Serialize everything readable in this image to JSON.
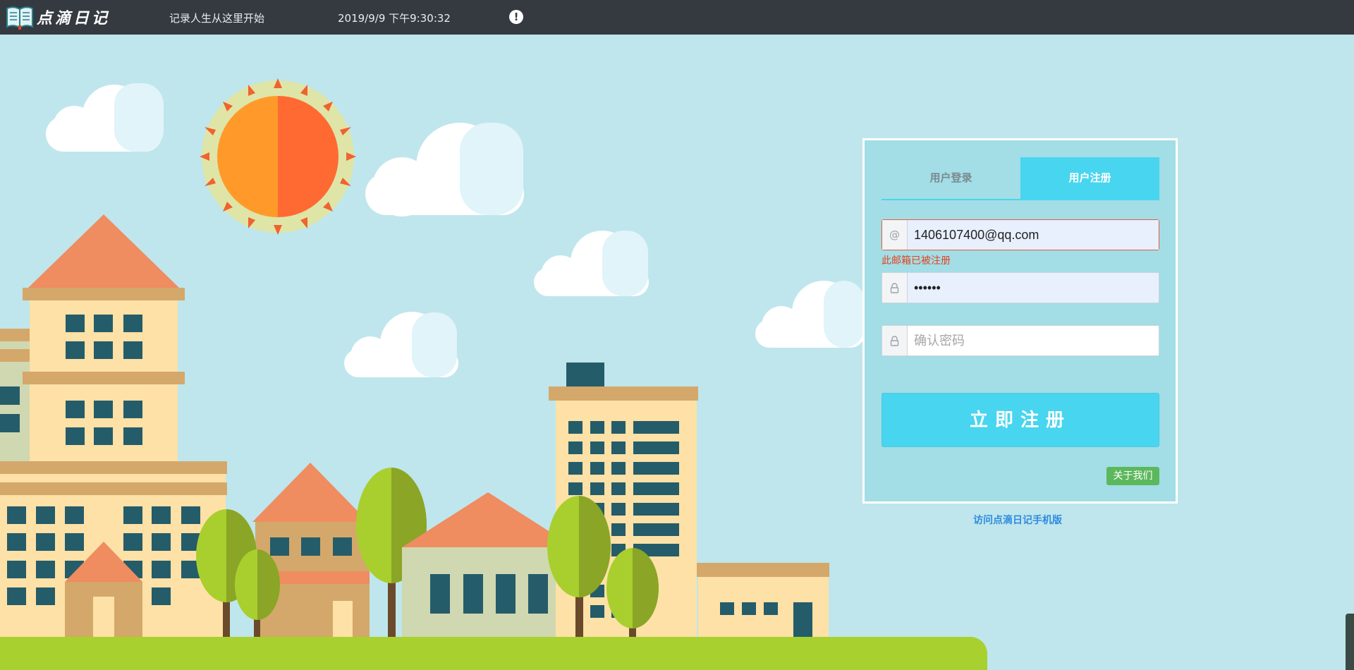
{
  "header": {
    "logo_text": "点滴日记",
    "tagline": "记录人生从这里开始",
    "datetime": "2019/9/9 下午9:30:32",
    "alert_symbol": "!"
  },
  "auth_panel": {
    "tabs": [
      {
        "label": "用户登录",
        "active": false
      },
      {
        "label": "用户注册",
        "active": true
      }
    ],
    "email": {
      "icon": "at-icon",
      "addon_symbol": "@",
      "value": "1406107400@qq.com"
    },
    "email_error": "此邮箱已被注册",
    "password": {
      "icon": "lock-icon",
      "value": "••••••"
    },
    "confirm_password": {
      "icon": "lock-icon",
      "placeholder": "确认密码"
    },
    "submit_label": "立即注册",
    "about_label": "关于我们"
  },
  "mobile_link": "访问点滴日记手机版",
  "colors": {
    "topbar": "#343a40",
    "sky": "#bfe6ec",
    "accent": "#48d5ef",
    "success": "#5cb85c",
    "error": "#e0441f"
  }
}
